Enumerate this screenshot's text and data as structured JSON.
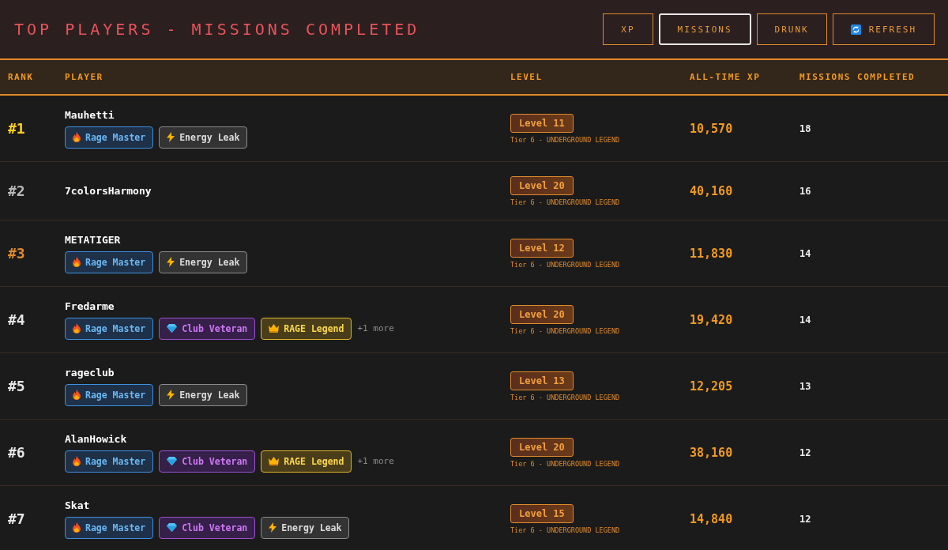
{
  "title": "TOP PLAYERS - MISSIONS COMPLETED",
  "tabs": [
    {
      "label": "XP",
      "selected": false
    },
    {
      "label": "MISSIONS",
      "selected": true
    },
    {
      "label": "DRUNK",
      "selected": false
    }
  ],
  "refresh_button": {
    "label": "REFRESH"
  },
  "columns": [
    "RANK",
    "PLAYER",
    "LEVEL",
    "ALL-TIME XP",
    "MISSIONS COMPLETED"
  ],
  "rows": [
    {
      "rank": "#1",
      "color": "#ffd21f",
      "player": "Mauhetti",
      "badges": [
        {
          "kind": "rage",
          "label": "Rage Master"
        },
        {
          "kind": "energy",
          "label": "Energy Leak"
        }
      ],
      "level": "Level 11",
      "tier": "Tier 6 - UNDERGROUND LEGEND",
      "xp": "10,570",
      "missions": "18"
    },
    {
      "rank": "#2",
      "color": "#b8b8b8",
      "player": "7colorsHarmony",
      "badges": [],
      "level": "Level 20",
      "tier": "Tier 6 - UNDERGROUND LEGEND",
      "xp": "40,160",
      "missions": "16"
    },
    {
      "rank": "#3",
      "color": "#e08a2c",
      "player": "METATIGER",
      "badges": [
        {
          "kind": "rage",
          "label": "Rage Master"
        },
        {
          "kind": "energy",
          "label": "Energy Leak"
        }
      ],
      "level": "Level 12",
      "tier": "Tier 6 - UNDERGROUND LEGEND",
      "xp": "11,830",
      "missions": "14"
    },
    {
      "rank": "#4",
      "color": "#e6e6e6",
      "player": "Fredarme",
      "badges": [
        {
          "kind": "rage",
          "label": "Rage Master"
        },
        {
          "kind": "veteran",
          "label": "Club Veteran"
        },
        {
          "kind": "legend",
          "label": "RAGE Legend"
        }
      ],
      "more": "+1 more",
      "level": "Level 20",
      "tier": "Tier 6 - UNDERGROUND LEGEND",
      "xp": "19,420",
      "missions": "14"
    },
    {
      "rank": "#5",
      "color": "#e6e6e6",
      "player": "rageclub",
      "badges": [
        {
          "kind": "rage",
          "label": "Rage Master"
        },
        {
          "kind": "energy",
          "label": "Energy Leak"
        }
      ],
      "level": "Level 13",
      "tier": "Tier 6 - UNDERGROUND LEGEND",
      "xp": "12,205",
      "missions": "13"
    },
    {
      "rank": "#6",
      "color": "#e6e6e6",
      "player": "AlanHowick",
      "badges": [
        {
          "kind": "rage",
          "label": "Rage Master"
        },
        {
          "kind": "veteran",
          "label": "Club Veteran"
        },
        {
          "kind": "legend",
          "label": "RAGE Legend"
        }
      ],
      "more": "+1 more",
      "level": "Level 20",
      "tier": "Tier 6 - UNDERGROUND LEGEND",
      "xp": "38,160",
      "missions": "12"
    },
    {
      "rank": "#7",
      "color": "#e6e6e6",
      "player": "Skat",
      "badges": [
        {
          "kind": "rage",
          "label": "Rage Master"
        },
        {
          "kind": "veteran",
          "label": "Club Veteran"
        },
        {
          "kind": "energy",
          "label": "Energy Leak"
        }
      ],
      "level": "Level 15",
      "tier": "Tier 6 - UNDERGROUND LEGEND",
      "xp": "14,840",
      "missions": "12"
    }
  ]
}
